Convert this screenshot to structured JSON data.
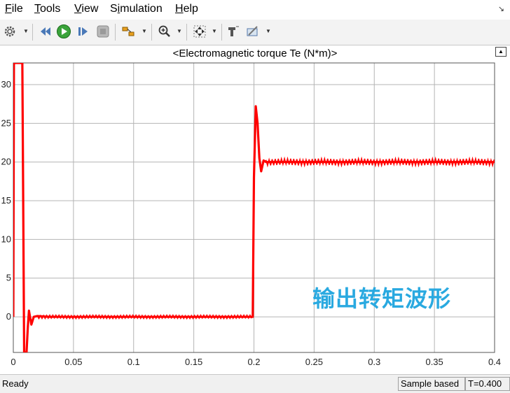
{
  "menu": {
    "file": {
      "u": "F",
      "rest": "ile"
    },
    "tools": {
      "u": "T",
      "rest": "ools"
    },
    "view": {
      "u": "V",
      "rest": "iew"
    },
    "simulation": {
      "pre": "S",
      "u": "i",
      "rest": "mulation"
    },
    "help": {
      "u": "H",
      "rest": "elp"
    }
  },
  "toolbar_icons": [
    "gear-icon",
    "step-back-icon",
    "run-icon",
    "step-forward-icon",
    "stop-icon",
    "signal-select-icon",
    "zoom-in-icon",
    "fit-to-view-icon",
    "highlight-icon",
    "style-icon"
  ],
  "overlay_caption": "输出转矩波形",
  "status": {
    "ready": "Ready",
    "mode": "Sample based",
    "time": "T=0.400"
  },
  "colors": {
    "trace": "#ff0000",
    "caption": "#29a9e0"
  },
  "chart_data": {
    "type": "line",
    "title": "<Electromagnetic torque Te (N*m)>",
    "xlabel": "",
    "ylabel": "",
    "xlim": [
      0,
      0.4
    ],
    "ylim": [
      -4.6,
      32.8
    ],
    "xticks": [
      "0",
      "0.05",
      "0.1",
      "0.15",
      "0.2",
      "0.25",
      "0.3",
      "0.35",
      "0.4"
    ],
    "yticks": [
      "0",
      "5",
      "10",
      "15",
      "20",
      "25",
      "30"
    ],
    "grid": true,
    "series": [
      {
        "color": "#ff0000",
        "x": [
          0,
          0.0005,
          0.0015,
          0.004,
          0.0075,
          0.009,
          0.0105,
          0.011,
          0.012,
          0.013,
          0.015,
          0.017,
          0.02,
          0.03,
          0.05,
          0.1,
          0.15,
          0.19,
          0.199,
          0.2,
          0.2015,
          0.203,
          0.2045,
          0.206,
          0.208,
          0.21,
          0.22,
          0.25,
          0.3,
          0.35,
          0.4
        ],
        "y": [
          0,
          32.8,
          32.8,
          32.8,
          32.8,
          -4.6,
          -4.6,
          -4.6,
          -1.5,
          0.8,
          -1,
          0,
          0.1,
          0,
          0,
          0,
          0,
          0,
          0,
          18,
          27.2,
          25,
          20.5,
          18.8,
          20.2,
          20,
          20,
          20,
          20,
          20,
          20
        ]
      }
    ]
  }
}
